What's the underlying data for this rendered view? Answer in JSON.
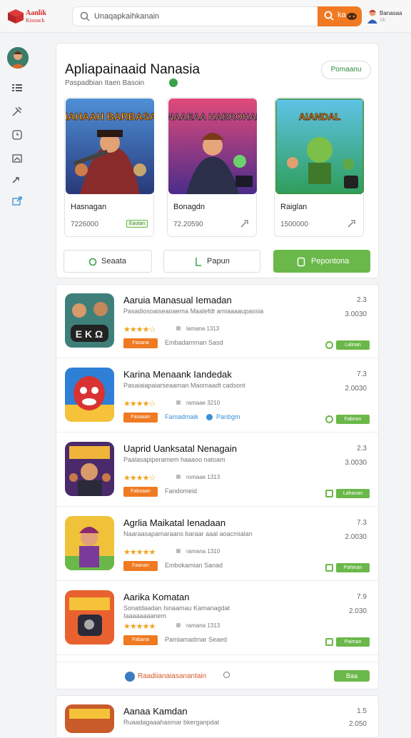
{
  "header": {
    "logo_line1": "Aanlik",
    "logo_line2": "Ktsouck",
    "search_placeholder": "Unaqapkaihkanain",
    "search_btn_text": "ka",
    "user_name": "Banasaa",
    "user_sub": "Sk"
  },
  "featured": {
    "title": "Apliapainaaid Nanasia",
    "subtitle": "Paspadbian Itaen Basoin",
    "action_label": "Pomaanu",
    "cards": [
      {
        "name": "Hasnagan",
        "count": "7226000",
        "tag": "Eautan",
        "banner_text": "HAHAAH BARBASAI"
      },
      {
        "name": "Bonagdn",
        "count": "72.20590",
        "banner_text": "NAAEAA HABROHAI"
      },
      {
        "name": "Raiglan",
        "count": "1500000",
        "banner_text": "AIANDAL"
      }
    ]
  },
  "filters": [
    {
      "label": "Seaata"
    },
    {
      "label": "Papun"
    },
    {
      "label": "Pepontona"
    }
  ],
  "list": {
    "items": [
      {
        "title": "Aaruia Manasual Iemadan",
        "desc": "Pasadiosoaiseaoaema Maalefdt amiaaaaupassia",
        "stars": "★★★★☆",
        "meta": "lamana  1313",
        "tag": "Fasana",
        "dev": "Embadamman Sasd",
        "ver": "2.3",
        "size": "3.0030",
        "dl": "Lalinan",
        "icon_text": "E K Ω"
      },
      {
        "title": "Karina Menaank Iandedak",
        "desc": "Pasaiaiapaiarseaaman Maomaadt cadsont",
        "stars": "★★★★☆",
        "meta": "ramaae  3210",
        "tag": "Fasaaan",
        "dev": "Famadmaik",
        "dev2": "Panbgm",
        "ver": "7.3",
        "size": "2.0030",
        "dl": "Fabnan"
      },
      {
        "title": "Uaprid Uanksatal Nenagain",
        "desc": "Paalasapiperamem haaaoo natoam",
        "stars": "★★★★☆",
        "meta": "romaae  1313",
        "tag": "Faboaan",
        "dev": "Fandomeid",
        "ver": "2.3",
        "size": "3.0030",
        "dl": "Lahanan"
      },
      {
        "title": "Agrlia Maikatal Ienadaan",
        "desc": "Naaraasapamaraans baraar aaal aoacmialan",
        "stars": "★★★★★",
        "meta": "ramana  1310",
        "tag": "Faanan",
        "dev": "Embokamian Sanad",
        "ver": "7.3",
        "size": "2.0030",
        "dl": "Pahinan"
      },
      {
        "title": "Aarika Komatan",
        "desc": "Sonatdaadan Isnaamau Kamanagdat Iaaaaaaaanem",
        "stars": "★★★★★",
        "meta": "ramana  1313",
        "tag": "Fabana",
        "dev": "Pamiamadmar Seaed",
        "ver": "7.9",
        "size": "2.030",
        "dl": "Paiman"
      }
    ],
    "pager_label": "Raadiianaiasanantain",
    "pager_button": "Baa"
  },
  "extra_item": {
    "title": "Aanaa Kamdan",
    "desc": "Ruaadagaaahasmar bkerganpdat",
    "ver": "1.5",
    "size": "2.050"
  }
}
